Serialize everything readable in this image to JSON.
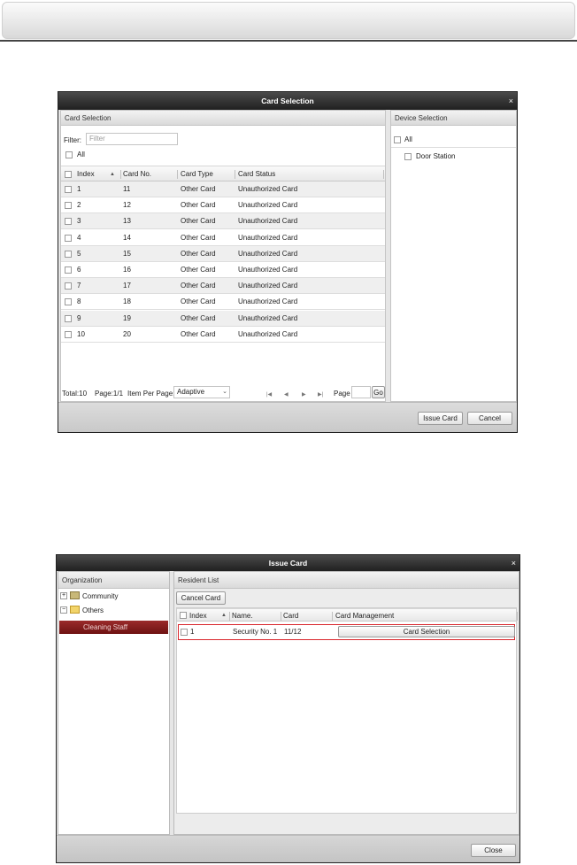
{
  "card_selection_dialog": {
    "title": "Card Selection",
    "close_glyph": "×",
    "left_pane": {
      "header": "Card Selection",
      "filter_label": "Filter:",
      "filter_placeholder": "Filter",
      "all_label": "All",
      "columns": [
        "Index",
        "Card No.",
        "Card Type",
        "Card Status"
      ],
      "sort_glyph": "▲",
      "rows": [
        {
          "index": "1",
          "card_no": "11",
          "card_type": "Other Card",
          "card_status": "Unauthorized Card"
        },
        {
          "index": "2",
          "card_no": "12",
          "card_type": "Other Card",
          "card_status": "Unauthorized Card"
        },
        {
          "index": "3",
          "card_no": "13",
          "card_type": "Other Card",
          "card_status": "Unauthorized Card"
        },
        {
          "index": "4",
          "card_no": "14",
          "card_type": "Other Card",
          "card_status": "Unauthorized Card"
        },
        {
          "index": "5",
          "card_no": "15",
          "card_type": "Other Card",
          "card_status": "Unauthorized Card"
        },
        {
          "index": "6",
          "card_no": "16",
          "card_type": "Other Card",
          "card_status": "Unauthorized Card"
        },
        {
          "index": "7",
          "card_no": "17",
          "card_type": "Other Card",
          "card_status": "Unauthorized Card"
        },
        {
          "index": "8",
          "card_no": "18",
          "card_type": "Other Card",
          "card_status": "Unauthorized Card"
        },
        {
          "index": "9",
          "card_no": "19",
          "card_type": "Other Card",
          "card_status": "Unauthorized Card"
        },
        {
          "index": "10",
          "card_no": "20",
          "card_type": "Other Card",
          "card_status": "Unauthorized Card"
        }
      ],
      "pagination": {
        "total": "Total:10",
        "page": "Page:1/1",
        "item_per_page_label": "Item Per Page:",
        "item_per_page_value": "Adaptive",
        "page_label": "Page",
        "go_label": "Go"
      }
    },
    "right_pane": {
      "header": "Device Selection",
      "all_label": "All",
      "device": "Door Station"
    },
    "issue_card_button": "Issue Card",
    "cancel_button": "Cancel"
  },
  "issue_card_dialog": {
    "title": "Issue Card",
    "close_glyph": "×",
    "organization": {
      "header": "Organization",
      "tree": [
        {
          "label": "Community",
          "toggle": "+"
        },
        {
          "label": "Others",
          "toggle": "−"
        }
      ],
      "selected_child": "Cleaning Staff"
    },
    "resident_list": {
      "header": "Resident List",
      "cancel_card_button": "Cancel Card",
      "columns": [
        "Index",
        "Name.",
        "Card",
        "Card Management"
      ],
      "sort_glyph": "▲",
      "rows": [
        {
          "index": "1",
          "name": "Security No. 1",
          "card": "11/12",
          "action": "Card Selection"
        }
      ]
    },
    "close_button": "Close"
  },
  "colors": {
    "title_bar": "#2a2a2a",
    "selected_item": "#8b1e1e",
    "highlight_border": "#d9262c"
  }
}
